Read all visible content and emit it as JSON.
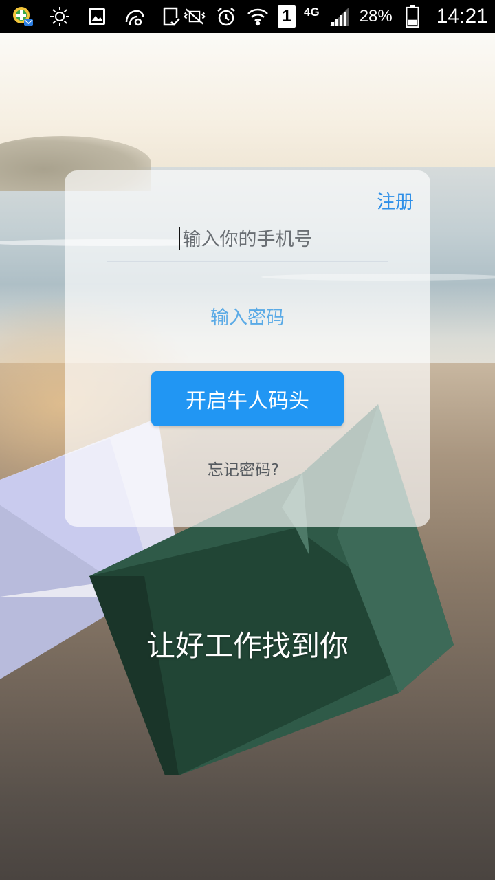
{
  "status_bar": {
    "icons_left": [
      "app-notification-icon",
      "brightness-icon",
      "gallery-icon",
      "browser-icon",
      "clipboard-check-icon"
    ],
    "icons_right": [
      "vibrate-mute-icon",
      "alarm-icon",
      "wifi-icon"
    ],
    "sim_slot": "1",
    "network_type": "4G",
    "battery_percent": "28%",
    "time": "14:21"
  },
  "login": {
    "register_label": "注册",
    "phone_placeholder": "输入你的手机号",
    "password_placeholder": "输入密码",
    "submit_label": "开启牛人码头",
    "forgot_password_label": "忘记密码?"
  },
  "slogan": "让好工作找到你",
  "colors": {
    "accent": "#2196f3",
    "link": "#2e8fe8",
    "card_background": "rgba(255,255,255,0.66)"
  }
}
